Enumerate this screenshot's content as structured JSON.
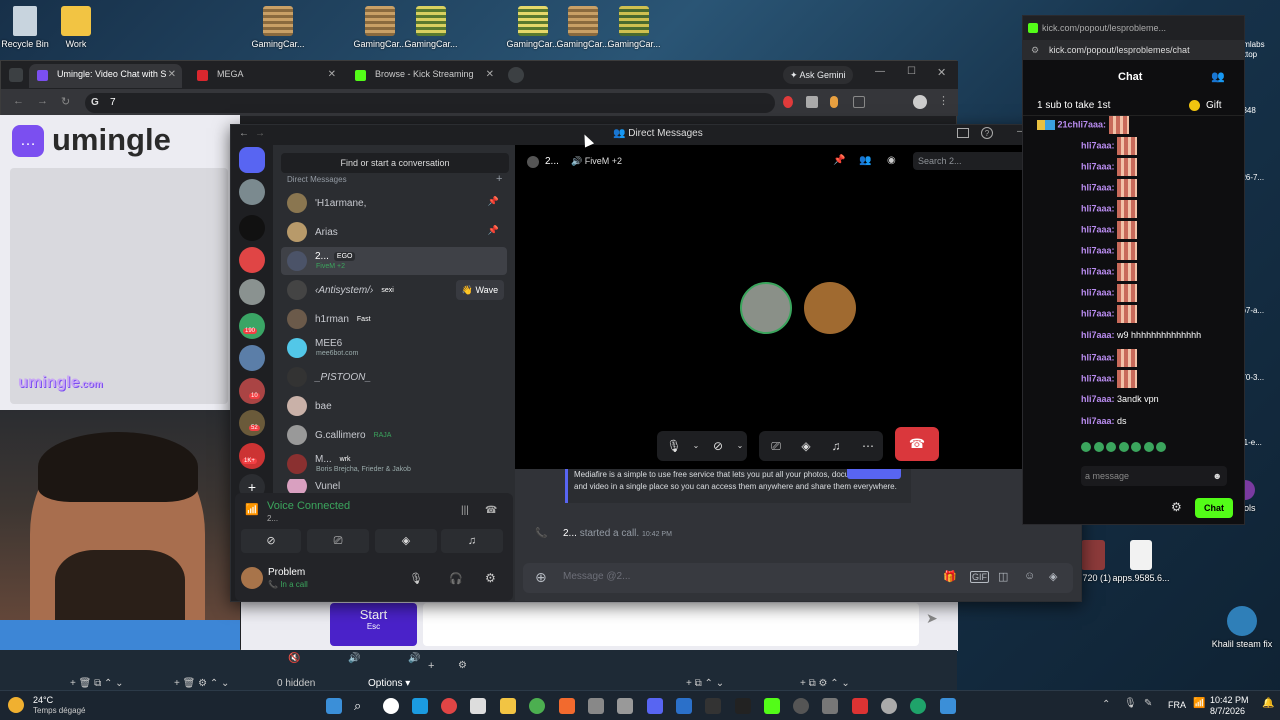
{
  "desktop": {
    "icons": [
      {
        "label": "Recycle Bin"
      },
      {
        "label": "Work"
      },
      {
        "label": "GamingCar..."
      },
      {
        "label": "GamingCar..."
      },
      {
        "label": "GamingCar..."
      },
      {
        "label": "GamingCar..."
      },
      {
        "label": "GamingCar..."
      },
      {
        "label": "GamingCar..."
      }
    ],
    "right_icons": [
      {
        "label": "...720 (1)"
      },
      {
        "label": "apps.9585.6..."
      },
      {
        "label": "Khalil steam fix"
      },
      {
        "label": "Tools"
      }
    ],
    "side_labels": [
      "lamlabs",
      "sktop",
      "4348",
      "326-7...",
      "0b7-a...",
      "070-3...",
      "ef1-e..."
    ]
  },
  "chrome": {
    "tabs": [
      {
        "title": "Umingle: Video Chat with S"
      },
      {
        "title": "MEGA"
      },
      {
        "title": "Browse - Kick Streaming"
      }
    ],
    "ask_gemini": "Ask Gemini",
    "address_value": "7"
  },
  "umingle": {
    "logo_text": "umingle",
    "watermark": "umingle",
    "watermark_suffix": ".com",
    "start_label": "Start",
    "start_sub": "Esc"
  },
  "discord": {
    "title": "Direct Messages",
    "search_button": "Find or start a conversation",
    "dm_header": "Direct Messages",
    "dm_header_add": "+",
    "server_badges": [
      "190",
      "10",
      "52",
      "1K+"
    ],
    "dms": [
      {
        "name": "'H1armane,",
        "pinned": true
      },
      {
        "name": "Arias",
        "pinned": true
      },
      {
        "name": "2...",
        "tag": "EGO",
        "sub": "FiveM +2"
      },
      {
        "name": "‹Antisystem/›",
        "tag": "sexi",
        "action": "Wave"
      },
      {
        "name": "h1rman",
        "tag": "Fast"
      },
      {
        "name": "MEE6",
        "sub": "mee6bot.com"
      },
      {
        "name": "_PISTOON_"
      },
      {
        "name": "bae"
      },
      {
        "name": "G.callimero",
        "tag": "RAJA"
      },
      {
        "name": "M...",
        "tag": "wrk",
        "sub": "Boris Brejcha, Frieder & Jakob"
      },
      {
        "name": "Vunel"
      }
    ],
    "voice": {
      "status": "Voice Connected",
      "channel": "2..."
    },
    "user": {
      "name": "Problem",
      "status": "In a call"
    },
    "call_header": {
      "name": "2...",
      "group": "FiveM +2"
    },
    "search_placeholder": "Search 2...",
    "message_text": "Mediafire is a simple to use free service that lets you put all your photos, documents, music, and video in a single place so you can access them anywhere and share them everywhere.",
    "call_event": {
      "user": "2...",
      "text": "started a call.",
      "time": "10:42 PM"
    },
    "composer_placeholder": "Message @2..."
  },
  "kick": {
    "popup_title": "kick.com/popout/lesprobleme...",
    "url": "kick.com/popout/lesproblemes/chat",
    "chat_title": "Chat",
    "pinned": "1 sub to take 1st",
    "gift": "Gift",
    "lines": [
      {
        "user": "21chli7aaa:",
        "text": ""
      },
      {
        "user": "hli7aaa:",
        "text": ""
      },
      {
        "user": "hli7aaa:",
        "text": ""
      },
      {
        "user": "hli7aaa:",
        "text": ""
      },
      {
        "user": "hli7aaa:",
        "text": ""
      },
      {
        "user": "hli7aaa:",
        "text": ""
      },
      {
        "user": "hli7aaa:",
        "text": ""
      },
      {
        "user": "hli7aaa:",
        "text": ""
      },
      {
        "user": "hli7aaa:",
        "text": ""
      },
      {
        "user": "hli7aaa:",
        "text": ""
      },
      {
        "user": "hli7aaa:",
        "text": "w9 hhhhhhhhhhhhhh"
      },
      {
        "user": "hli7aaa:",
        "text": ""
      },
      {
        "user": "hli7aaa:",
        "text": ""
      },
      {
        "user": "hli7aaa:",
        "text": "3andk vpn"
      },
      {
        "user": "hli7aaa:",
        "text": "ds"
      }
    ],
    "input_placeholder": "a message",
    "chat_button": "Chat"
  },
  "obs": {
    "hidden": "0 hidden",
    "options": "Options"
  },
  "taskbar": {
    "weather_temp": "24°C",
    "weather_desc": "Temps dégagé",
    "lang": "FRA",
    "time": "10:42 PM",
    "date": "8/7/2026"
  }
}
